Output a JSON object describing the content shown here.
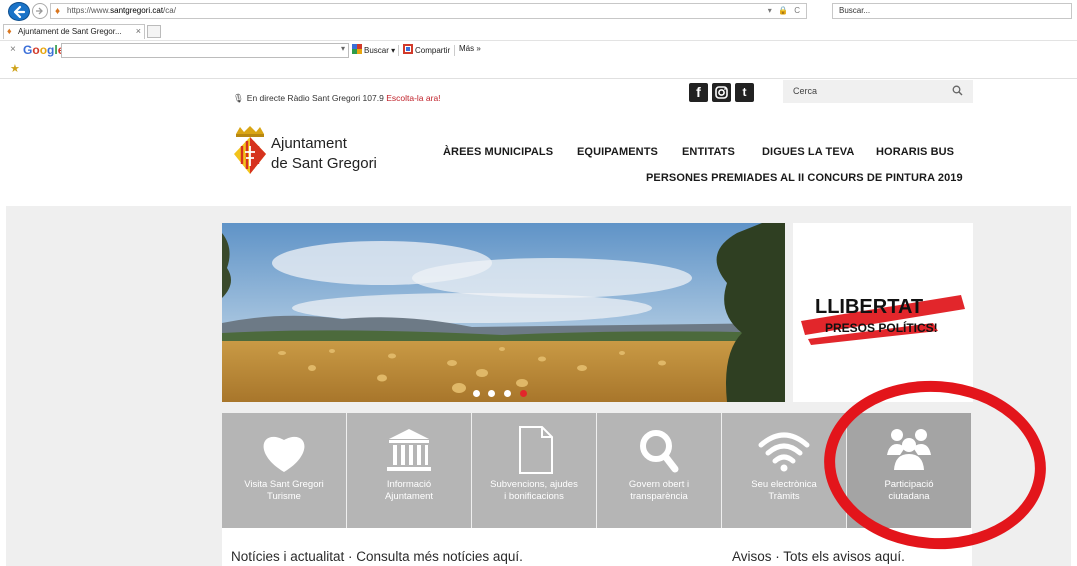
{
  "browser": {
    "url_prefix": "https://www.",
    "url_domain": "santgregori.cat",
    "url_path": "/ca/",
    "url_controls": "▾ 🔒 C",
    "search_placeholder": "Buscar...",
    "tab_title": "Ajuntament de Sant Gregor...",
    "tab_close": "×",
    "toolbar": {
      "close": "×",
      "google_logo": [
        "G",
        "o",
        "o",
        "g",
        "l",
        "e"
      ],
      "dropdown_arrow": "▾",
      "search_label": "Buscar ▾",
      "share_label": "Compartir",
      "more_label": "Más »"
    }
  },
  "site": {
    "radio_text": "En directe Ràdio Sant Gregori 107.9",
    "radio_link": "Escolta-la ara!",
    "social": {
      "fb": "f",
      "tw": "t"
    },
    "search_placeholder": "Cerca",
    "logo_line1": "Ajuntament",
    "logo_line2": "de Sant Gregori",
    "nav": [
      "ÀREES MUNICIPALS",
      "EQUIPAMENTS",
      "ENTITATS",
      "DIGUES LA TEVA",
      "HORARIS BUS",
      "PERSONES PREMIADES AL II CONCURS DE PINTURA 2019"
    ],
    "slider_active_dot": 4,
    "banner": {
      "line1": "LLIBERTAT",
      "line2": "PRESOS POLÍTICS!"
    },
    "tiles": [
      {
        "icon": "heart-icon",
        "line1": "Visita Sant Gregori",
        "line2": "Turisme"
      },
      {
        "icon": "building-icon",
        "line1": "Informació",
        "line2": "Ajuntament"
      },
      {
        "icon": "document-icon",
        "line1": "Subvencions, ajudes",
        "line2": "i bonificacions"
      },
      {
        "icon": "magnifier-icon",
        "line1": "Govern obert i",
        "line2": "transparència"
      },
      {
        "icon": "wifi-icon",
        "line1": "Seu electrònica",
        "line2": "Tràmits"
      },
      {
        "icon": "people-icon",
        "line1": "Participació",
        "line2": "ciutadana"
      }
    ],
    "news_heading": "Notícies i actualitat · Consulta més notícies aquí.",
    "notices_heading": "Avisos · Tots els avisos aquí."
  },
  "colors": {
    "accent_red": "#e2262b",
    "annotation_red": "#e3151b",
    "tile_grey": "#b5b5b5"
  }
}
